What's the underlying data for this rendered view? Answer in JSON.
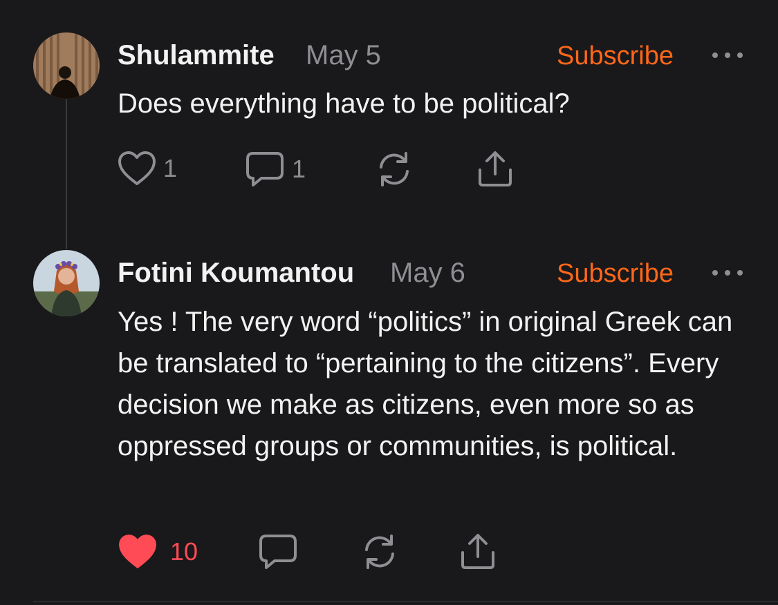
{
  "comments": [
    {
      "author": "Shulammite",
      "date": "May 5",
      "subscribe_label": "Subscribe",
      "text": "Does everything have to be political?",
      "likes": "1",
      "replies": "1",
      "liked": false
    },
    {
      "author": "Fotini Koumantou",
      "date": "May 6",
      "subscribe_label": "Subscribe",
      "text": "Yes ! The very word “politics” in original Greek can be translated to “pertaining to the citizens”. Every decision we make as citizens, even more so as oppressed groups or communities, is political.",
      "likes": "10",
      "liked": true
    }
  ],
  "colors": {
    "background": "#19191b",
    "accent": "#ff6719",
    "like_active": "#ff4b55",
    "muted": "#8e8e93"
  },
  "icons": [
    "heart-icon",
    "comment-icon",
    "restack-icon",
    "share-icon",
    "more-icon"
  ]
}
